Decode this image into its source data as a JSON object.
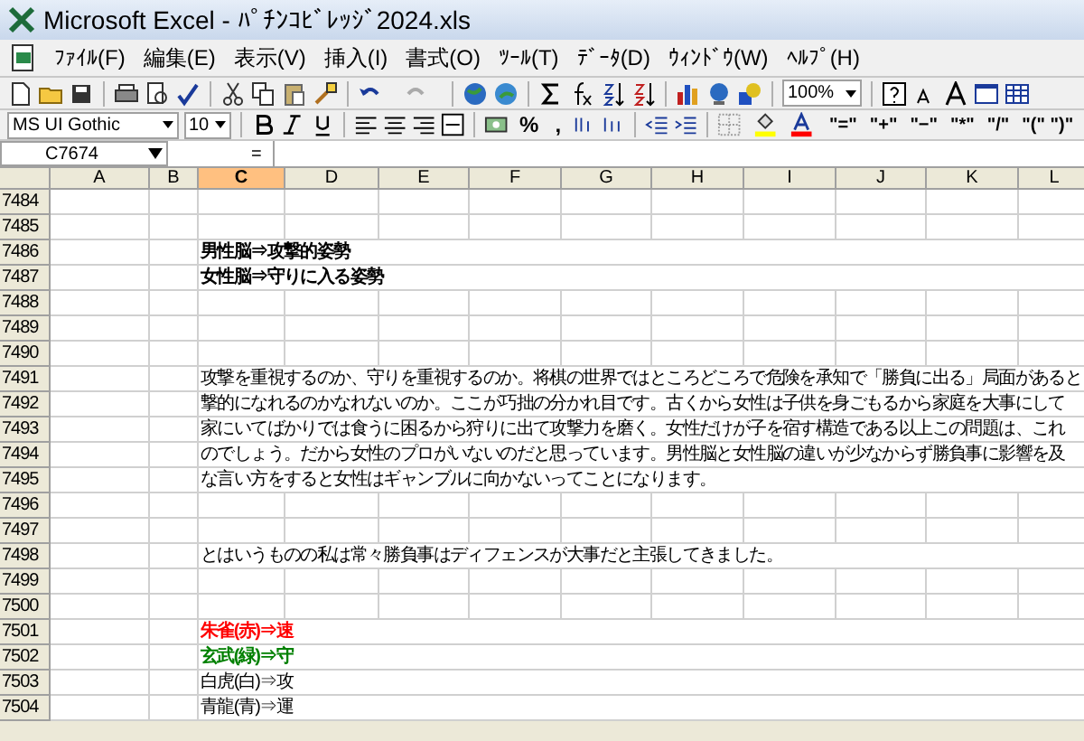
{
  "window": {
    "title": "Microsoft Excel - ﾊﾟﾁﾝｺﾋﾞﾚｯｼﾞ2024.xls"
  },
  "menu": [
    "ﾌｧｲﾙ(F)",
    "編集(E)",
    "表示(V)",
    "挿入(I)",
    "書式(O)",
    "ﾂｰﾙ(T)",
    "ﾃﾞｰﾀ(D)",
    "ｳｨﾝﾄﾞｳ(W)",
    "ﾍﾙﾌﾟ(H)"
  ],
  "standard_toolbar": {
    "zoom": "100%"
  },
  "formatting_toolbar": {
    "font": "MS UI Gothic",
    "size": "10",
    "buttons": [
      "%",
      ","
    ],
    "custom_buttons": [
      "\"=\"",
      "\"+\"",
      "\"−\"",
      "\"*\"",
      "\"/\"",
      "\"(\" \")\""
    ]
  },
  "formula_bar": {
    "name_box": "C7674",
    "equals": "="
  },
  "columns": [
    {
      "label": "A",
      "selected": false
    },
    {
      "label": "B",
      "selected": false
    },
    {
      "label": "C",
      "selected": true
    },
    {
      "label": "D",
      "selected": false
    },
    {
      "label": "E",
      "selected": false
    },
    {
      "label": "F",
      "selected": false
    },
    {
      "label": "G",
      "selected": false
    },
    {
      "label": "H",
      "selected": false
    },
    {
      "label": "I",
      "selected": false
    },
    {
      "label": "J",
      "selected": false
    },
    {
      "label": "K",
      "selected": false
    },
    {
      "label": "L",
      "selected": false
    }
  ],
  "rows": [
    {
      "number": "7484"
    },
    {
      "number": "7485"
    },
    {
      "number": "7486",
      "text": "男性脳⇒攻撃的姿勢",
      "bold": true
    },
    {
      "number": "7487",
      "text": "女性脳⇒守りに入る姿勢",
      "bold": true
    },
    {
      "number": "7488"
    },
    {
      "number": "7489"
    },
    {
      "number": "7490"
    },
    {
      "number": "7491",
      "text": "攻撃を重視するのか、守りを重視するのか。将棋の世界ではところどころで危険を承知で「勝負に出る」局面があると"
    },
    {
      "number": "7492",
      "text": "撃的になれるのかなれないのか。ここが巧拙の分かれ目です。古くから女性は子供を身ごもるから家庭を大事にして"
    },
    {
      "number": "7493",
      "text": "家にいてばかりでは食うに困るから狩りに出て攻撃力を磨く。女性だけが子を宿す構造である以上この問題は、これ"
    },
    {
      "number": "7494",
      "text": "のでしょう。だから女性のプロがいないのだと思っています。男性脳と女性脳の違いが少なからず勝負事に影響を及"
    },
    {
      "number": "7495",
      "text": "な言い方をすると女性はギャンブルに向かないってことになります。"
    },
    {
      "number": "7496"
    },
    {
      "number": "7497"
    },
    {
      "number": "7498",
      "text": "とはいうものの私は常々勝負事はディフェンスが大事だと主張してきました。"
    },
    {
      "number": "7499"
    },
    {
      "number": "7500"
    },
    {
      "number": "7501",
      "text": "朱雀(赤)⇒速",
      "bold": true,
      "color": "#ff0000"
    },
    {
      "number": "7502",
      "text": "玄武(緑)⇒守",
      "bold": true,
      "color": "#008000"
    },
    {
      "number": "7503",
      "text": "白虎(白)⇒攻",
      "bold": false,
      "color": "#000000"
    },
    {
      "number": "7504",
      "text": "青龍(青)⇒運",
      "bold": false,
      "color": "#000000"
    }
  ]
}
